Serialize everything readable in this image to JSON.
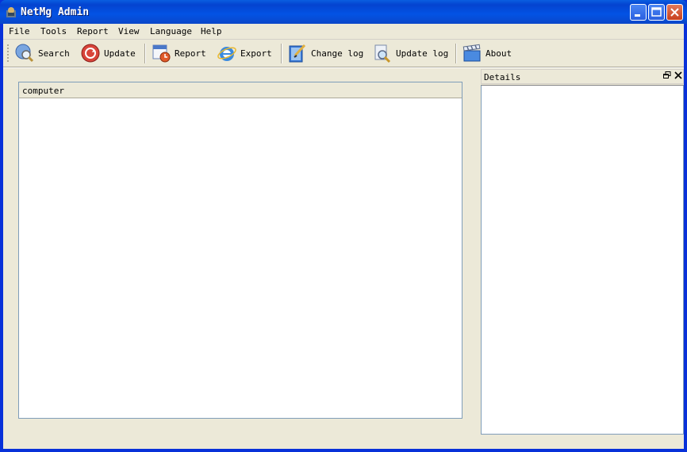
{
  "window": {
    "title": "NetMg Admin"
  },
  "menu": {
    "items": [
      "File",
      "Tools",
      "Report",
      "View",
      "Language",
      "Help"
    ]
  },
  "toolbar": {
    "buttons": [
      {
        "label": "Search",
        "icon": "search-globe-icon"
      },
      {
        "label": "Update",
        "icon": "update-icon"
      },
      {
        "label": "Report",
        "icon": "report-calendar-icon"
      },
      {
        "label": "Export",
        "icon": "ie-icon"
      },
      {
        "label": "Change log",
        "icon": "change-log-icon"
      },
      {
        "label": "Update log",
        "icon": "update-log-icon"
      },
      {
        "label": "About",
        "icon": "clapperboard-icon"
      }
    ]
  },
  "list": {
    "column_header": "computer",
    "rows": []
  },
  "details": {
    "title": "Details",
    "restore_icon": "restore-icon",
    "close_icon": "close-icon"
  }
}
